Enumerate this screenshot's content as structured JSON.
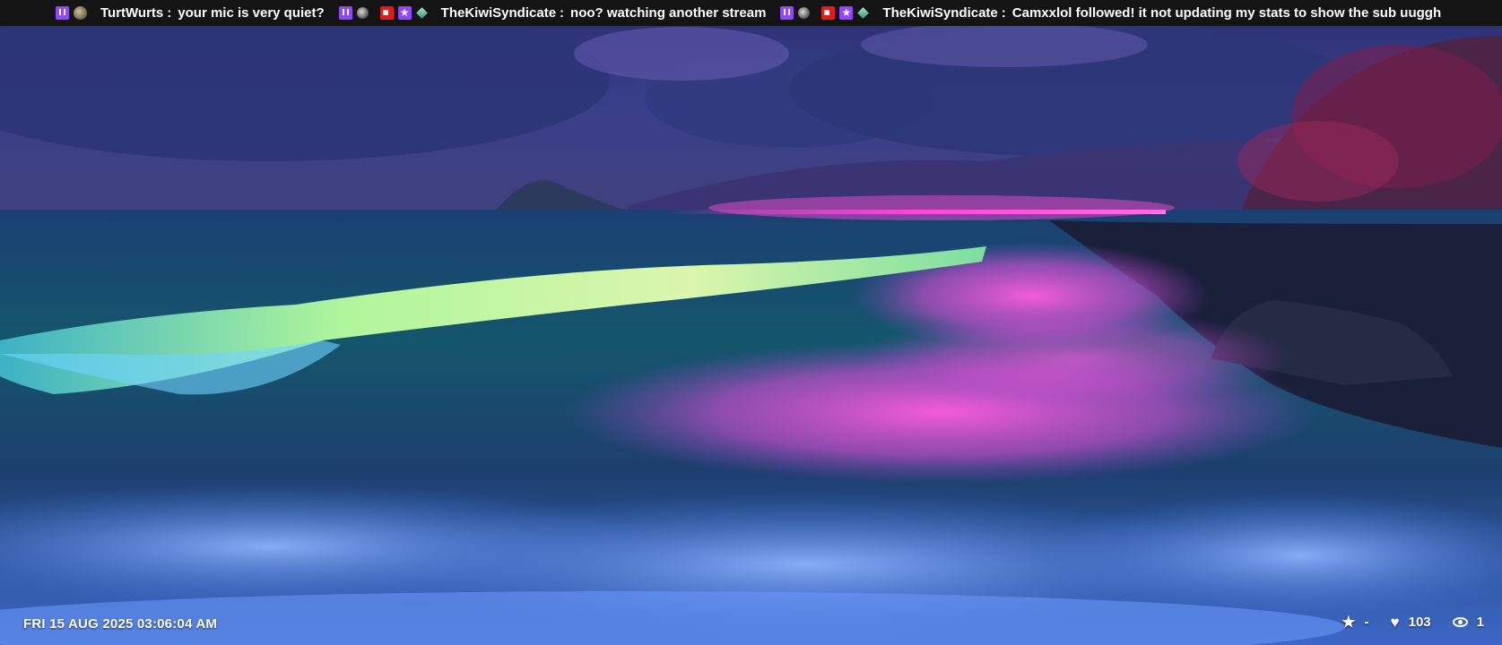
{
  "chat": {
    "messages": [
      {
        "badges": [
          "twitch-icon",
          "mod-badge-icon"
        ],
        "user": "TurtWurts",
        "separator": ":",
        "text": "your mic is very quiet?"
      },
      {
        "badges": [
          "twitch-icon",
          "user-badge-icon",
          "broadcaster-badge-icon",
          "star-badge-icon",
          "gem-badge-icon"
        ],
        "user": "TheKiwiSyndicate",
        "separator": ":",
        "text": "noo?  watching another stream"
      },
      {
        "badges": [
          "twitch-icon",
          "user-badge-icon",
          "broadcaster-badge-icon",
          "star-badge-icon",
          "gem-badge-icon"
        ],
        "user": "TheKiwiSyndicate",
        "separator": ":",
        "text": "Camxxlol followed!  it not updating my stats to show the sub uuggh"
      }
    ]
  },
  "overlay": {
    "clock": "FRI 15 AUG 2025 03:06:04 AM",
    "stats": {
      "star_value": "-",
      "likes_value": "103",
      "viewers_value": "1"
    }
  },
  "colors": {
    "ticker_bg": "#141414",
    "twitch_purple": "#9146ff",
    "live_red": "#e91916",
    "sky": "#2b3372",
    "neon_pink": "#ff4fd8",
    "wave_green": "#c8ff9c"
  }
}
